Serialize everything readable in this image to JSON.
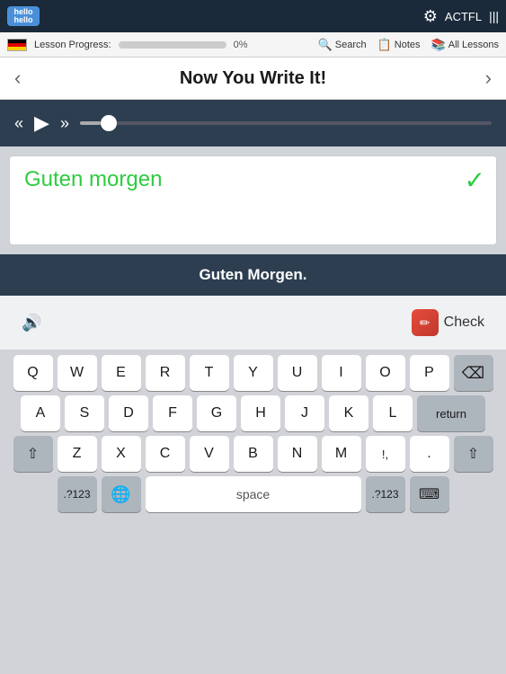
{
  "app": {
    "logo": "hello-hello",
    "dot": "•",
    "actfl": "ACTFL"
  },
  "progress": {
    "label": "Lesson Progress:",
    "percent": "0%",
    "fill": 0
  },
  "nav": {
    "search": "Search",
    "notes": "Notes",
    "all_lessons": "All Lessons"
  },
  "section": {
    "title": "Now You Write It!",
    "prev": "‹",
    "next": "›"
  },
  "audio": {
    "rewind": "«",
    "play": "▶",
    "forward": "»"
  },
  "writing": {
    "text": "Guten morgen",
    "checkmark": "✓"
  },
  "answer": {
    "text": "Guten Morgen."
  },
  "actions": {
    "check_label": "Check",
    "check_icon": "✎"
  },
  "keyboard": {
    "row1": [
      "Q",
      "W",
      "E",
      "R",
      "T",
      "Y",
      "U",
      "I",
      "O",
      "P"
    ],
    "row2": [
      "A",
      "S",
      "D",
      "F",
      "G",
      "H",
      "J",
      "K",
      "L"
    ],
    "row3_left": [
      "⇧"
    ],
    "row3_mid": [
      "Z",
      "X",
      "C",
      "V",
      "B",
      "N",
      "M"
    ],
    "row3_right": [
      "!,",
      ".",
      "⌫"
    ],
    "bottom_left": [
      ".?123",
      "🌐"
    ],
    "bottom_space": "space",
    "bottom_right": [
      ".?123",
      "⌨"
    ],
    "return_label": "return"
  }
}
